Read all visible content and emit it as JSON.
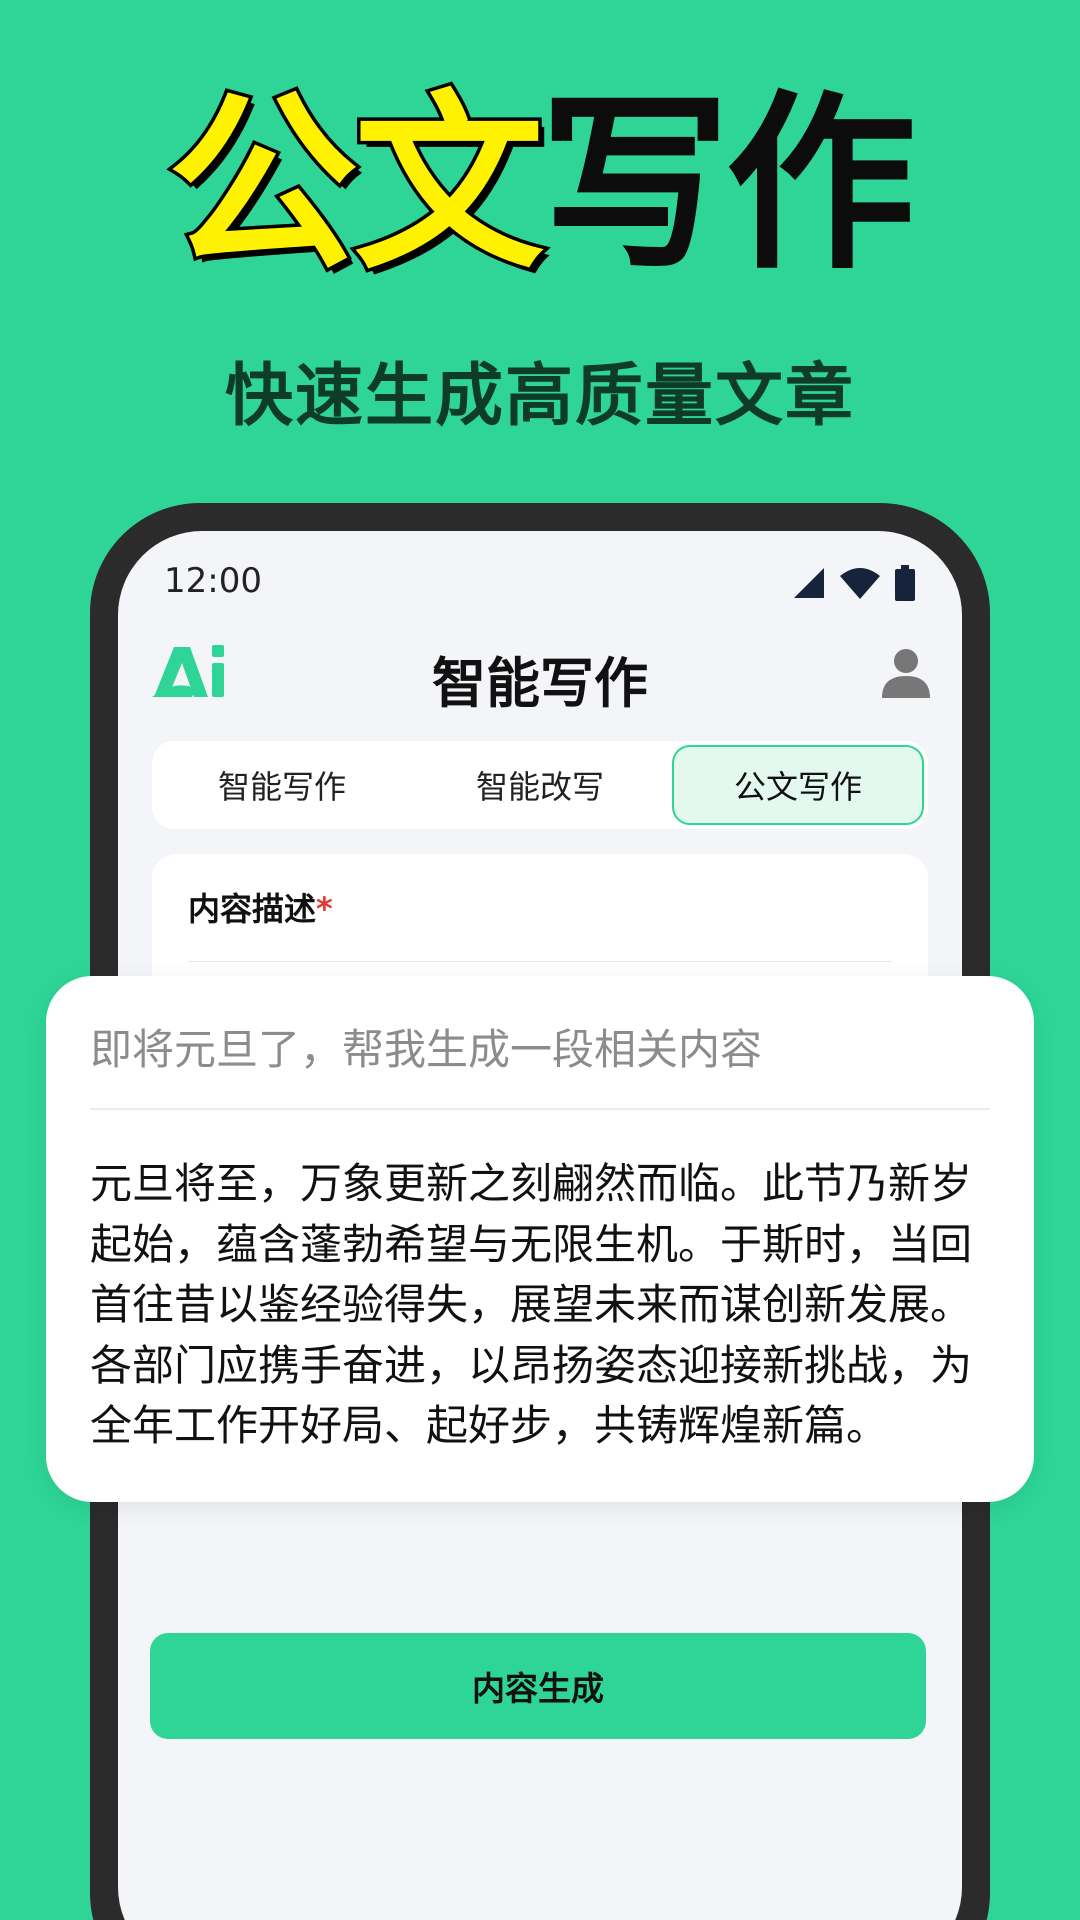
{
  "hero": {
    "title_part1": "公文",
    "title_part2": "写作",
    "subtitle": "快速生成高质量文章"
  },
  "colors": {
    "background": "#2ed597",
    "highlight_yellow": "#fff200",
    "accent_green": "#2ed597",
    "required_red": "#e53935"
  },
  "status_bar": {
    "time": "12:00",
    "icons": [
      "signal-icon",
      "wifi-icon",
      "battery-icon"
    ]
  },
  "header": {
    "logo_text": "Ai",
    "title": "智能写作",
    "avatar_icon": "user-icon"
  },
  "tabs": [
    {
      "label": "智能写作",
      "active": false
    },
    {
      "label": "智能改写",
      "active": false
    },
    {
      "label": "公文写作",
      "active": true
    }
  ],
  "form": {
    "label": "内容描述",
    "required_mark": "*"
  },
  "popup": {
    "query": "即将元旦了，帮我生成一段相关内容",
    "result_lines": [
      "元旦将至，万象更新之刻翩然而临。此节乃新岁",
      "起始，蕴含蓬勃希望与无限生机。于斯时，当回",
      "首往昔以鉴经验得失，展望未来而谋创新发展。",
      "各部门应携手奋进，以昂扬姿态迎接新挑战，为",
      "全年工作开好局、起好步，共铸辉煌新篇。"
    ]
  },
  "actions": {
    "generate_label": "内容生成"
  }
}
